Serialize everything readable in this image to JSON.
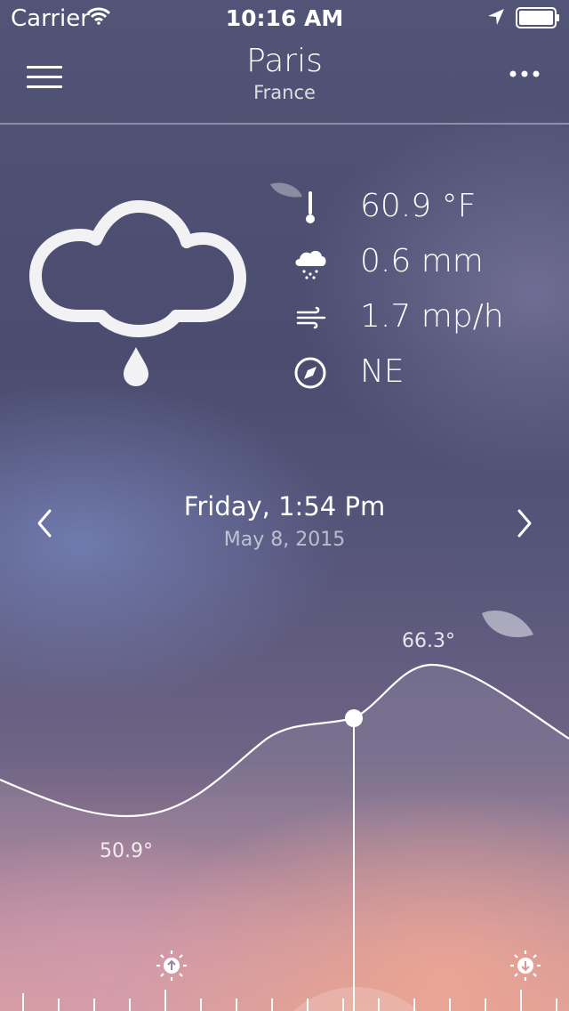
{
  "status_bar": {
    "carrier": "Carrier",
    "time": "10:16 AM"
  },
  "header": {
    "city": "Paris",
    "country": "France"
  },
  "current": {
    "condition_icon": "rain-cloud-icon",
    "temperature": "60.9 °F",
    "precipitation": "0.6 mm",
    "wind_speed": "1.7 mp/h",
    "wind_direction": "NE"
  },
  "date_nav": {
    "day_time": "Friday, 1:54 Pm",
    "date": "May 8, 2015"
  },
  "temp_chart": {
    "high_label": "66.3°",
    "low_label": "50.9°",
    "selected_fraction": 0.62
  },
  "colors": {
    "text": "#ffffff",
    "bg_top": "#525477",
    "bg_bottom": "#d79a97"
  }
}
